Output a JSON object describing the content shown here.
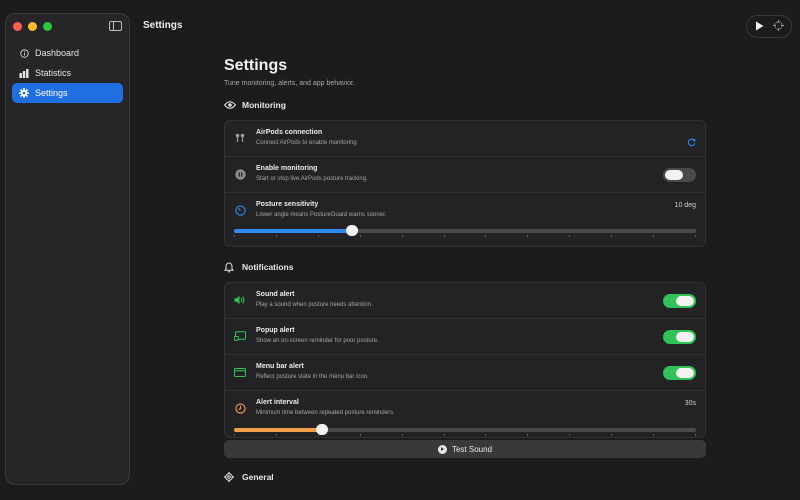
{
  "app": {
    "window_title": "Settings"
  },
  "sidebar": {
    "items": [
      {
        "label": "Dashboard",
        "icon": "info-circle-icon",
        "active": false
      },
      {
        "label": "Statistics",
        "icon": "bar-chart-icon",
        "active": false
      },
      {
        "label": "Settings",
        "icon": "gear-icon",
        "active": true
      }
    ]
  },
  "toolbar": {
    "run_icon": "play-icon",
    "target_icon": "crosshair-icon"
  },
  "page": {
    "title": "Settings",
    "subtitle": "Tune monitoring, alerts, and app behavior."
  },
  "monitoring": {
    "header": "Monitoring",
    "airpods": {
      "title": "AirPods connection",
      "subtitle": "Connect AirPods to enable monitoring"
    },
    "enable": {
      "title": "Enable monitoring",
      "subtitle": "Start or stop live AirPods posture tracking.",
      "on": false
    },
    "sensitivity": {
      "title": "Posture sensitivity",
      "subtitle": "Lower angle means PostureGuard warns sooner.",
      "value": "10 deg",
      "fraction": 0.255
    }
  },
  "notifications": {
    "header": "Notifications",
    "sound": {
      "title": "Sound alert",
      "subtitle": "Play a sound when posture needs attention.",
      "on": true
    },
    "popup": {
      "title": "Popup alert",
      "subtitle": "Show an on-screen reminder for poor posture.",
      "on": true
    },
    "menubar": {
      "title": "Menu bar alert",
      "subtitle": "Reflect posture state in the menu bar icon.",
      "on": true
    },
    "interval": {
      "title": "Alert interval",
      "subtitle": "Minimum time between repeated posture reminders.",
      "value": "30s",
      "fraction": 0.19
    },
    "test_button": "Test Sound"
  },
  "general": {
    "header": "General"
  },
  "colors": {
    "accent_blue": "#1f6fe0",
    "toggle_green": "#30c257",
    "slider_blue": "#2f8cf5",
    "slider_orange": "#f0a04b"
  }
}
